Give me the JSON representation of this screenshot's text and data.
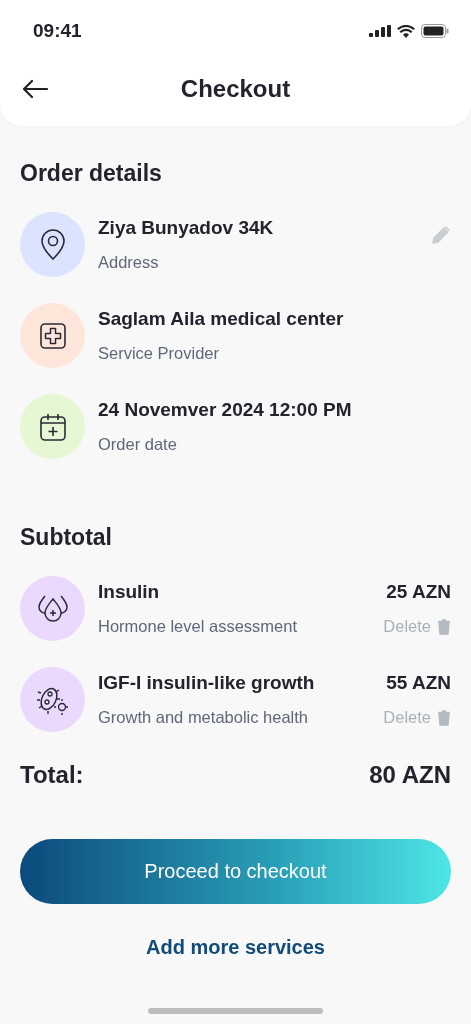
{
  "status_bar": {
    "time": "09:41"
  },
  "header": {
    "title": "Checkout"
  },
  "order_details": {
    "title": "Order details",
    "items": [
      {
        "kind": "location",
        "color": "#dce3ff",
        "title": "Ziya Bunyadov 34K",
        "subtitle": "Address",
        "editable": true
      },
      {
        "kind": "medical",
        "color": "#ffe6da",
        "title": "Saglam Aila medical center",
        "subtitle": "Service Provider",
        "editable": false
      },
      {
        "kind": "calendar",
        "color": "#e6f7d3",
        "title": "24 Novemver 2024 12:00 PM",
        "subtitle": "Order date",
        "editable": false
      }
    ]
  },
  "subtotal": {
    "title": "Subtotal",
    "items": [
      {
        "kind": "drops",
        "color": "#ead9fd",
        "title": "Insulin",
        "subtitle": "Hormone level assessment",
        "price": "25 AZN",
        "delete_label": "Delete"
      },
      {
        "kind": "microbe",
        "color": "#ead9fd",
        "title": "IGF-I insulin-like growth",
        "subtitle": "Growth and metabolic health",
        "price": "55 AZN",
        "delete_label": "Delete"
      }
    ]
  },
  "total": {
    "label": "Total:",
    "value": "80 AZN"
  },
  "primary_button": "Proceed to checkout",
  "secondary_link": "Add more services"
}
